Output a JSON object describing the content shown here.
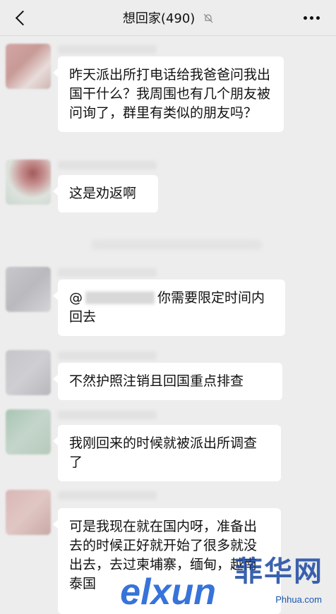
{
  "header": {
    "title": "想回家(490)",
    "back_icon": "chevron-left-icon",
    "mute_icon": "bell-off-icon",
    "more_icon": "more-dots-icon"
  },
  "messages": [
    {
      "text": "昨天派出所打电话给我爸爸问我出国干什么？我周围也有几个朋友被问询了，群里有类似的朋友吗？"
    },
    {
      "text": "这是劝返啊"
    },
    {
      "prefix": "@",
      "text": "你需要限定时间内回去"
    },
    {
      "text": "不然护照注销且回国重点排查"
    },
    {
      "text": "我刚回来的时候就被派出所调查了"
    },
    {
      "text": "可是我现在就在国内呀，准备出去的时候正好就开始了很多就没出去，去过柬埔寨，缅甸，越南泰国"
    }
  ],
  "watermark": {
    "brand": "elxun",
    "cn": "菲华网",
    "url": "Phhua.com"
  },
  "colors": {
    "background": "#ededed",
    "bubble": "#ffffff",
    "watermark": "#1a56b0"
  }
}
